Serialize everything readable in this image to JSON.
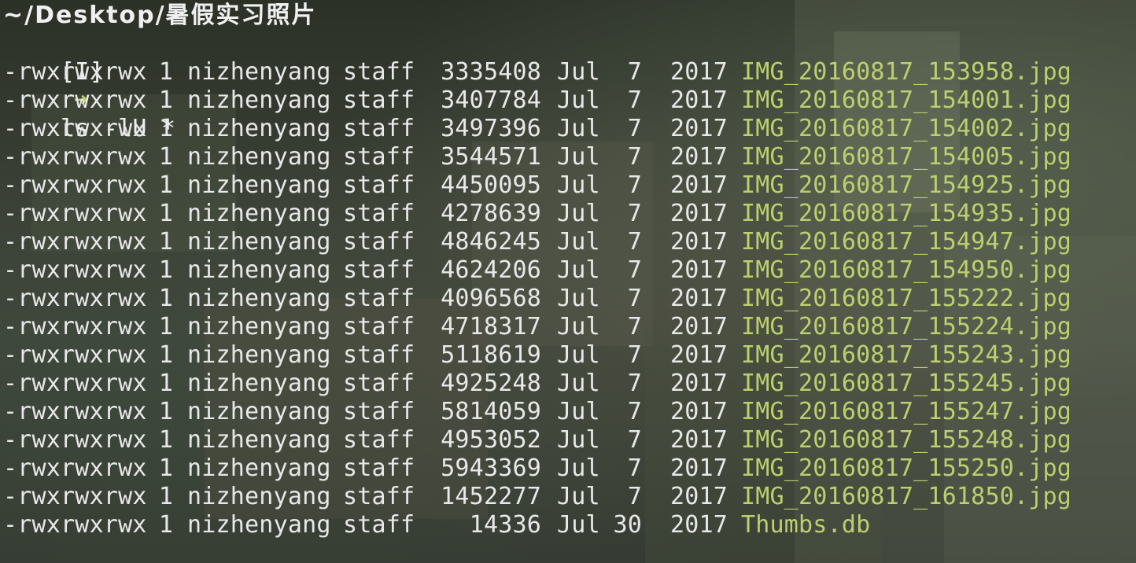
{
  "terminal": {
    "cwd": "~/Desktop/暑假实习照片",
    "prompt_mode": "[I]",
    "prompt_icon": "arrow-right-icon",
    "command": "ls -lU *",
    "colors": {
      "text": "#e8e8e8",
      "filename": "#bcd06e",
      "prompt_arrow": "#b9d36b"
    },
    "entries": [
      {
        "perms": "-rwxrwxrwx",
        "links": "1",
        "owner": "nizhenyang",
        "group": "staff",
        "size": "3335408",
        "month": "Jul",
        "day": "7",
        "year": "2017",
        "name": "IMG_20160817_153958.jpg"
      },
      {
        "perms": "-rwxrwxrwx",
        "links": "1",
        "owner": "nizhenyang",
        "group": "staff",
        "size": "3407784",
        "month": "Jul",
        "day": "7",
        "year": "2017",
        "name": "IMG_20160817_154001.jpg"
      },
      {
        "perms": "-rwxrwxrwx",
        "links": "1",
        "owner": "nizhenyang",
        "group": "staff",
        "size": "3497396",
        "month": "Jul",
        "day": "7",
        "year": "2017",
        "name": "IMG_20160817_154002.jpg"
      },
      {
        "perms": "-rwxrwxrwx",
        "links": "1",
        "owner": "nizhenyang",
        "group": "staff",
        "size": "3544571",
        "month": "Jul",
        "day": "7",
        "year": "2017",
        "name": "IMG_20160817_154005.jpg"
      },
      {
        "perms": "-rwxrwxrwx",
        "links": "1",
        "owner": "nizhenyang",
        "group": "staff",
        "size": "4450095",
        "month": "Jul",
        "day": "7",
        "year": "2017",
        "name": "IMG_20160817_154925.jpg"
      },
      {
        "perms": "-rwxrwxrwx",
        "links": "1",
        "owner": "nizhenyang",
        "group": "staff",
        "size": "4278639",
        "month": "Jul",
        "day": "7",
        "year": "2017",
        "name": "IMG_20160817_154935.jpg"
      },
      {
        "perms": "-rwxrwxrwx",
        "links": "1",
        "owner": "nizhenyang",
        "group": "staff",
        "size": "4846245",
        "month": "Jul",
        "day": "7",
        "year": "2017",
        "name": "IMG_20160817_154947.jpg"
      },
      {
        "perms": "-rwxrwxrwx",
        "links": "1",
        "owner": "nizhenyang",
        "group": "staff",
        "size": "4624206",
        "month": "Jul",
        "day": "7",
        "year": "2017",
        "name": "IMG_20160817_154950.jpg"
      },
      {
        "perms": "-rwxrwxrwx",
        "links": "1",
        "owner": "nizhenyang",
        "group": "staff",
        "size": "4096568",
        "month": "Jul",
        "day": "7",
        "year": "2017",
        "name": "IMG_20160817_155222.jpg"
      },
      {
        "perms": "-rwxrwxrwx",
        "links": "1",
        "owner": "nizhenyang",
        "group": "staff",
        "size": "4718317",
        "month": "Jul",
        "day": "7",
        "year": "2017",
        "name": "IMG_20160817_155224.jpg"
      },
      {
        "perms": "-rwxrwxrwx",
        "links": "1",
        "owner": "nizhenyang",
        "group": "staff",
        "size": "5118619",
        "month": "Jul",
        "day": "7",
        "year": "2017",
        "name": "IMG_20160817_155243.jpg"
      },
      {
        "perms": "-rwxrwxrwx",
        "links": "1",
        "owner": "nizhenyang",
        "group": "staff",
        "size": "4925248",
        "month": "Jul",
        "day": "7",
        "year": "2017",
        "name": "IMG_20160817_155245.jpg"
      },
      {
        "perms": "-rwxrwxrwx",
        "links": "1",
        "owner": "nizhenyang",
        "group": "staff",
        "size": "5814059",
        "month": "Jul",
        "day": "7",
        "year": "2017",
        "name": "IMG_20160817_155247.jpg"
      },
      {
        "perms": "-rwxrwxrwx",
        "links": "1",
        "owner": "nizhenyang",
        "group": "staff",
        "size": "4953052",
        "month": "Jul",
        "day": "7",
        "year": "2017",
        "name": "IMG_20160817_155248.jpg"
      },
      {
        "perms": "-rwxrwxrwx",
        "links": "1",
        "owner": "nizhenyang",
        "group": "staff",
        "size": "5943369",
        "month": "Jul",
        "day": "7",
        "year": "2017",
        "name": "IMG_20160817_155250.jpg"
      },
      {
        "perms": "-rwxrwxrwx",
        "links": "1",
        "owner": "nizhenyang",
        "group": "staff",
        "size": "1452277",
        "month": "Jul",
        "day": "7",
        "year": "2017",
        "name": "IMG_20160817_161850.jpg"
      },
      {
        "perms": "-rwxrwxrwx",
        "links": "1",
        "owner": "nizhenyang",
        "group": "staff",
        "size": "14336",
        "month": "Jul",
        "day": "30",
        "year": "2017",
        "name": "Thumbs.db"
      }
    ]
  }
}
